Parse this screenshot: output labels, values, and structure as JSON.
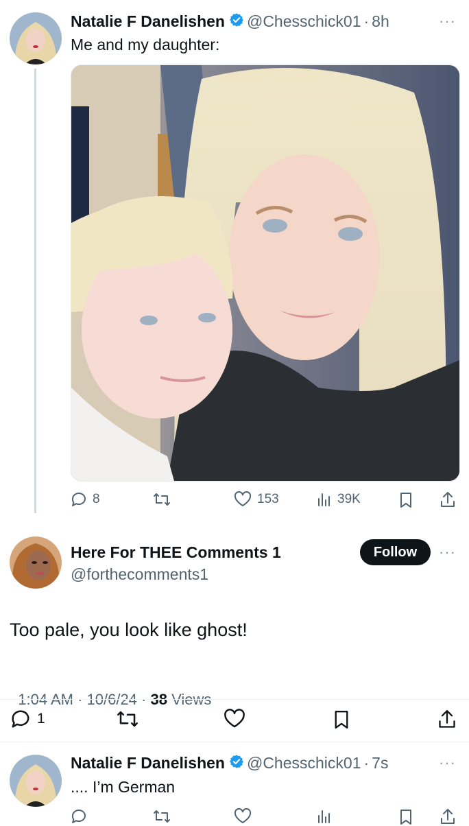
{
  "tweet1": {
    "author": "Natalie F Danelishen",
    "handle": "@Chesschick01",
    "time_sep": "·",
    "time": "8h",
    "more": "···",
    "text": "Me and my daughter:",
    "actions": {
      "replies": "8",
      "likes": "153",
      "views": "39K"
    }
  },
  "reply": {
    "author": "Here For THEE Comments 1",
    "handle": "@forthecomments1",
    "follow_label": "Follow",
    "more": "···",
    "text": "Too pale, you look like ghost!",
    "meta": {
      "time": "1:04 AM",
      "sep1": " · ",
      "date": "10/6/24",
      "sep2": " · ",
      "views_count": "38",
      "views_label": " Views"
    },
    "actions": {
      "replies": "1"
    }
  },
  "tweet2": {
    "author": "Natalie F Danelishen",
    "handle": "@Chesschick01",
    "time_sep": "·",
    "time": "7s",
    "more": "···",
    "text": ".... I’m German"
  },
  "colors": {
    "text": "#0f1419",
    "muted": "#536471",
    "verified": "#1d9bf0",
    "thread_line": "#cfd9de",
    "follow_bg": "#0f1419"
  }
}
